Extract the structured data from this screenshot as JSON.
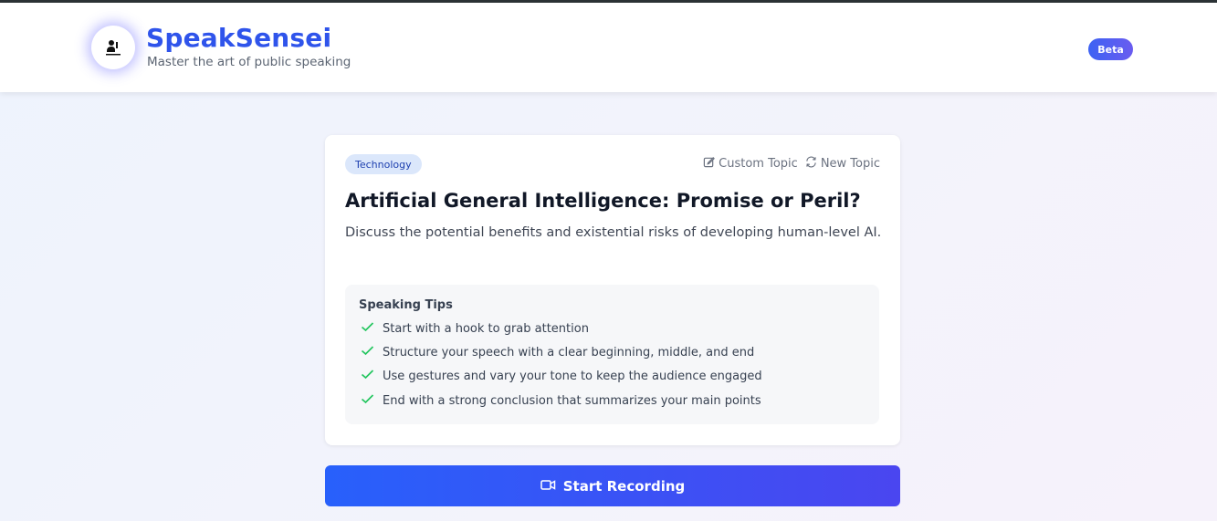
{
  "header": {
    "title": "SpeakSensei",
    "subtitle": "Master the art of public speaking",
    "badge": "Beta"
  },
  "topic": {
    "category": "Technology",
    "custom_label": "Custom Topic",
    "new_label": "New Topic",
    "title": "Artificial General Intelligence: Promise or Peril?",
    "description": "Discuss the potential benefits and existential risks of developing human-level AI."
  },
  "tips": {
    "heading": "Speaking Tips",
    "items": [
      "Start with a hook to grab attention",
      "Structure your speech with a clear beginning, middle, and end",
      "Use gestures and vary your tone to keep the audience engaged",
      "End with a strong conclusion that summarizes your main points"
    ]
  },
  "record_button": {
    "label": "Start Recording"
  },
  "icons": {
    "logo": "speaker-logo-icon",
    "custom": "edit-icon",
    "new": "refresh-icon",
    "check": "check-icon",
    "record": "video-camera-icon"
  },
  "colors": {
    "brand": "#2f54eb",
    "accent_start": "#2860fb",
    "accent_end": "#4a46f0",
    "check": "#22c55e",
    "tag_bg": "#dbe7fb"
  }
}
